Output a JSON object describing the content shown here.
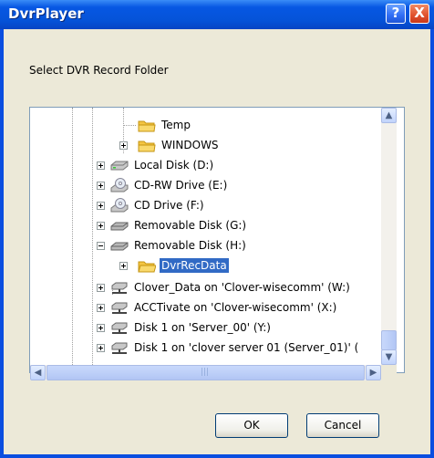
{
  "window": {
    "title": "DvrPlayer",
    "help_label": "?",
    "close_label": "X"
  },
  "dialog": {
    "prompt": "Select DVR Record Folder"
  },
  "tree": {
    "items": [
      {
        "label": "Temp",
        "icon": "folder-icon"
      },
      {
        "label": "WINDOWS",
        "icon": "folder-icon"
      },
      {
        "label": "Local Disk (D:)",
        "icon": "hard-drive-icon"
      },
      {
        "label": "CD-RW Drive (E:)",
        "icon": "cd-drive-icon"
      },
      {
        "label": "CD Drive (F:)",
        "icon": "cd-drive-icon"
      },
      {
        "label": "Removable Disk (G:)",
        "icon": "removable-disk-icon"
      },
      {
        "label": "Removable Disk (H:)",
        "icon": "removable-disk-icon"
      },
      {
        "label": "DvrRecData",
        "icon": "folder-icon",
        "selected": true
      },
      {
        "label": "Clover_Data on 'Clover-wisecomm' (W:)",
        "icon": "network-drive-icon"
      },
      {
        "label": "ACCTivate on 'Clover-wisecomm' (X:)",
        "icon": "network-drive-icon"
      },
      {
        "label": "Disk 1 on 'Server_00'  (Y:)",
        "icon": "network-drive-icon"
      },
      {
        "label": "Disk 1 on 'clover server 01 (Server_01)' (",
        "icon": "network-drive-icon"
      }
    ]
  },
  "buttons": {
    "ok": "OK",
    "cancel": "Cancel"
  },
  "colors": {
    "selection": "#316ac5",
    "titlebar": "#0553d8",
    "dialog_bg": "#ece9d8"
  }
}
